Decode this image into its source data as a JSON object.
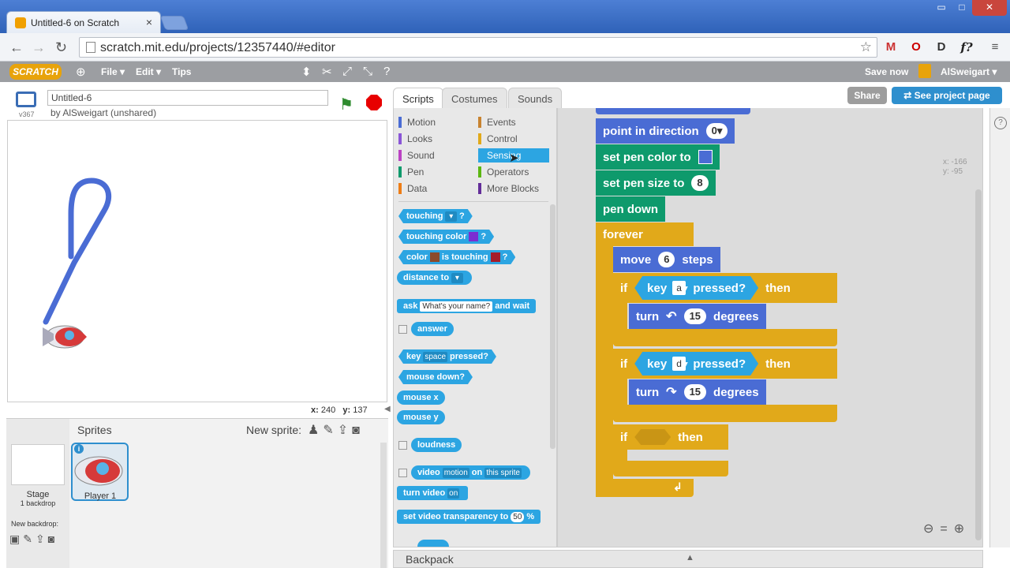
{
  "browser": {
    "tab_title": "Untitled-6 on Scratch",
    "tab_close": "×",
    "url": "scratch.mit.edu/projects/12357440/#editor",
    "window_min": "▭",
    "window_max": "□",
    "window_close": "✕",
    "extensions": [
      "M",
      "O",
      "D",
      "f?"
    ]
  },
  "menubar": {
    "logo": "SCRATCH",
    "file": "File ▾",
    "edit": "Edit ▾",
    "tips": "Tips",
    "save_now": "Save now",
    "user": "AlSweigart ▾"
  },
  "stage_header": {
    "version": "v367",
    "title_value": "Untitled-6",
    "byline": "by AlSweigart (unshared)"
  },
  "mouse": {
    "x_label": "x:",
    "x": "240",
    "y_label": "y:",
    "y": "137"
  },
  "sprites": {
    "title": "Sprites",
    "new_sprite_label": "New sprite:",
    "stage_label": "Stage",
    "stage_backdrops": "1 backdrop",
    "new_backdrop_label": "New backdrop:",
    "sprite_name": "Player 1",
    "info": "i"
  },
  "tabs": {
    "scripts": "Scripts",
    "costumes": "Costumes",
    "sounds": "Sounds"
  },
  "buttons": {
    "share": "Share",
    "see_project": "See project page"
  },
  "categories": {
    "motion": "Motion",
    "looks": "Looks",
    "sound": "Sound",
    "pen": "Pen",
    "data": "Data",
    "events": "Events",
    "control": "Control",
    "sensing": "Sensing",
    "operators": "Operators",
    "more": "More Blocks"
  },
  "category_colors": {
    "motion": "#4a6cd4",
    "looks": "#8a55d7",
    "sound": "#bb42c3",
    "pen": "#0e9a6c",
    "data": "#ee7d16",
    "events": "#c88330",
    "control": "#e1a91a",
    "sensing": "#2ca5e2",
    "operators": "#5cb712",
    "more": "#632d99"
  },
  "palette": {
    "touching": "touching",
    "touching_q": "?",
    "touching_color": "touching color",
    "touching_color_q": "?",
    "color_is": "color",
    "is_touching": "is touching",
    "color_is_q": "?",
    "distance_to": "distance to",
    "ask": "ask",
    "ask_default": "What's your name?",
    "and_wait": "and wait",
    "answer": "answer",
    "key": "key",
    "key_default": "space",
    "pressed": "pressed?",
    "mouse_down": "mouse down?",
    "mouse_x": "mouse x",
    "mouse_y": "mouse y",
    "loudness": "loudness",
    "video": "video",
    "video_motion": "motion",
    "on": "on",
    "this_sprite": "this sprite",
    "turn_video": "turn video",
    "turn_video_on": "on",
    "set_video_transparency": "set video transparency to",
    "transparency_value": "50",
    "percent": "%"
  },
  "script": {
    "point_in_direction": "point in direction",
    "direction_value": "0▾",
    "set_pen_color": "set pen color to",
    "set_pen_size": "set pen size to",
    "pen_size_value": "8",
    "pen_down": "pen down",
    "forever": "forever",
    "move": "move",
    "move_value": "6",
    "steps": "steps",
    "if": "if",
    "then": "then",
    "key": "key",
    "key_a": "a",
    "key_d": "d",
    "pressed": "pressed?",
    "turn": "turn",
    "turn_value": "15",
    "degrees": "degrees",
    "ghost_x": "x: -166",
    "ghost_y": "y: -95"
  },
  "backpack": {
    "label": "Backpack",
    "arrow": "▲"
  },
  "zoom": {
    "out": "⊖",
    "reset": "=",
    "in": "⊕"
  }
}
